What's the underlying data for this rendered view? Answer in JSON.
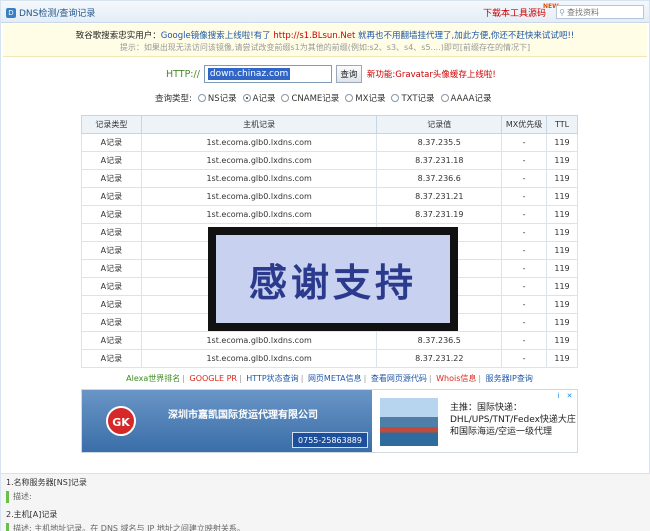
{
  "header": {
    "title": "DNS检测/查询记录",
    "download_link": "下载本工具源码",
    "new_badge": "NEW",
    "search_placeholder": "查找资料"
  },
  "notice": {
    "prefix": "致谷歌搜索忠实用户：",
    "google_text": "Google镜像搜索上线啦!有了",
    "url": "http://s1.BLsun.Net",
    "suffix": "就再也不用翻墙挂代理了,加此方便,你还不赶快来试试吧!!",
    "tip": "提示：如果出现无法访问该镜像,请尝试改变前缀s1为其他的前缀(例如:s2、s3、s4、s5....)即可[前缀存在的情况下]"
  },
  "query": {
    "http_label": "HTTP://",
    "domain_value": "down.chinaz.com",
    "button_label": "查询",
    "new_feature": "新功能:Gravatar头像缓存上线啦!"
  },
  "record_types": {
    "label": "查询类型:",
    "options": [
      "NS记录",
      "A记录",
      "CNAME记录",
      "MX记录",
      "TXT记录",
      "AAAA记录"
    ],
    "selected": "A记录"
  },
  "table": {
    "headers": [
      "记录类型",
      "主机记录",
      "记录值",
      "MX优先级",
      "TTL"
    ],
    "rows": [
      [
        "A记录",
        "1st.ecoma.glb0.lxdns.com",
        "8.37.235.5",
        "-",
        "119"
      ],
      [
        "A记录",
        "1st.ecoma.glb0.lxdns.com",
        "8.37.231.18",
        "-",
        "119"
      ],
      [
        "A记录",
        "1st.ecoma.glb0.lxdns.com",
        "8.37.236.6",
        "-",
        "119"
      ],
      [
        "A记录",
        "1st.ecoma.glb0.lxdns.com",
        "8.37.231.21",
        "-",
        "119"
      ],
      [
        "A记录",
        "1st.ecoma.glb0.lxdns.com",
        "8.37.231.19",
        "-",
        "119"
      ],
      [
        "A记录",
        "",
        "",
        "-",
        "119"
      ],
      [
        "A记录",
        "",
        "",
        "-",
        "119"
      ],
      [
        "A记录",
        "",
        "",
        "-",
        "119"
      ],
      [
        "A记录",
        "",
        "",
        "-",
        "119"
      ],
      [
        "A记录",
        "",
        "",
        "-",
        "119"
      ],
      [
        "A记录",
        "",
        "",
        "-",
        "119"
      ],
      [
        "A记录",
        "1st.ecoma.glb0.lxdns.com",
        "8.37.236.5",
        "-",
        "119"
      ],
      [
        "A记录",
        "1st.ecoma.glb0.lxdns.com",
        "8.37.231.22",
        "-",
        "119"
      ]
    ]
  },
  "overlay": {
    "text": "感谢支持"
  },
  "tool_links": {
    "alexa": "Alexa世界排名",
    "google_pr": "GOOGLE PR",
    "http_status": "HTTP状态查询",
    "meta": "网页META信息",
    "source": "查看网页源代码",
    "whois": "Whois信息",
    "ip": "服务器IP查询"
  },
  "ad": {
    "logo_text": "GK",
    "company": "深圳市嘉凯国际货运代理有限公司",
    "phone": "0755-25863889",
    "text": "主推：国际快递：DHL/UPS/TNT/Fedex快递大庄和国际海运/空运一级代理",
    "close": "✕",
    "info": "i"
  },
  "descriptions": [
    {
      "title": "1.名称服务器[NS]记录",
      "body": "描述:"
    },
    {
      "title": "2.主机[A]记录",
      "body": "描述: 主机地址记录。在 DNS 域名与 IP 地址之间建立映射关系。"
    }
  ],
  "colors": {
    "accent": "#1f57a8",
    "alert_red": "#cc0000",
    "notice_bg": "#fffde6"
  }
}
